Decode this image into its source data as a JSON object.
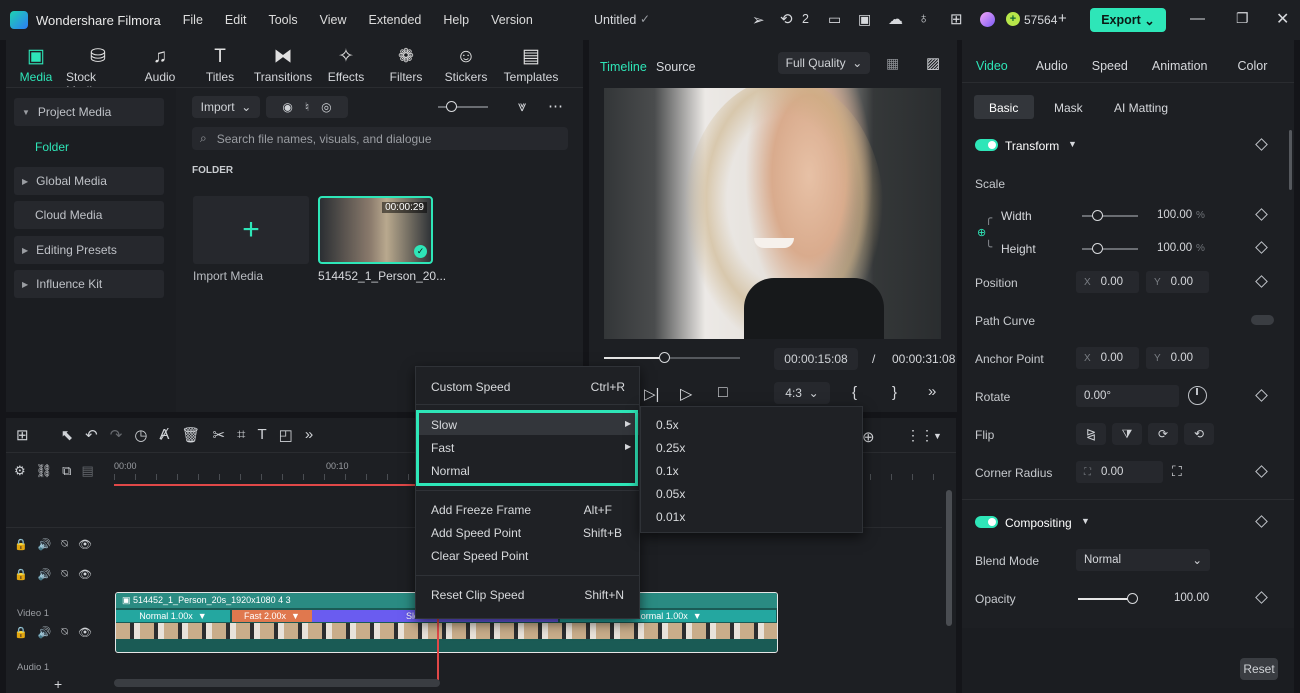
{
  "titlebar": {
    "app_name": "Wondershare Filmora",
    "menu": [
      "File",
      "Edit",
      "Tools",
      "View",
      "Extended",
      "Help",
      "Version"
    ],
    "project_title": "Untitled",
    "badge_count": "2",
    "credits": "57564",
    "export_label": "Export"
  },
  "media_toolbar": {
    "tools": [
      {
        "label": "Media",
        "glyph": "▣",
        "name": "media"
      },
      {
        "label": "Stock Media",
        "glyph": "⛁",
        "name": "stock-media"
      },
      {
        "label": "Audio",
        "glyph": "♫",
        "name": "audio"
      },
      {
        "label": "Titles",
        "glyph": "T",
        "name": "titles"
      },
      {
        "label": "Transitions",
        "glyph": "⧓",
        "name": "transitions"
      },
      {
        "label": "Effects",
        "glyph": "✧",
        "name": "effects"
      },
      {
        "label": "Filters",
        "glyph": "❁",
        "name": "filters"
      },
      {
        "label": "Stickers",
        "glyph": "☺",
        "name": "stickers"
      },
      {
        "label": "Templates",
        "glyph": "▤",
        "name": "templates"
      }
    ]
  },
  "sidebar": {
    "project_media": "Project Media",
    "folder": "Folder",
    "global_media": "Global Media",
    "cloud_media": "Cloud Media",
    "editing_presets": "Editing Presets",
    "influence_kit": "Influence Kit"
  },
  "media_panel": {
    "import_label": "Import",
    "search_placeholder": "Search file names, visuals, and dialogue",
    "folder_heading": "FOLDER",
    "import_media_label": "Import Media",
    "clip_name": "514452_1_Person_20...",
    "clip_duration": "00:00:29"
  },
  "preview": {
    "tab_timeline": "Timeline",
    "tab_source": "Source",
    "quality": "Full Quality",
    "current_time": "00:00:15:08",
    "separator": "/",
    "total_time": "00:00:31:08",
    "aspect": "4:3",
    "progress": 0.44
  },
  "properties": {
    "tabs": [
      "Video",
      "Audio",
      "Speed",
      "Animation",
      "Color"
    ],
    "subtabs": [
      "Basic",
      "Mask",
      "AI Matting"
    ],
    "transform": "Transform",
    "scale": "Scale",
    "width_label": "Width",
    "width_value": "100.00",
    "height_label": "Height",
    "height_value": "100.00",
    "percent": "%",
    "position": "Position",
    "pos_x": "0.00",
    "pos_y": "0.00",
    "x_prefix": "X",
    "y_prefix": "Y",
    "path_curve": "Path Curve",
    "anchor_point": "Anchor Point",
    "anchor_x": "0.00",
    "anchor_y": "0.00",
    "rotate": "Rotate",
    "rotate_value": "0.00°",
    "flip": "Flip",
    "corner_radius": "Corner Radius",
    "corner_value": "0.00",
    "compositing": "Compositing",
    "blend_mode": "Blend Mode",
    "blend_value": "Normal",
    "opacity": "Opacity",
    "opacity_value": "100.00",
    "reset": "Reset"
  },
  "timeline": {
    "ruler": [
      "00:00",
      "00:10"
    ],
    "video_track": "Video 1",
    "audio_track": "Audio 1",
    "clip_title": "514452_1_Person_20s_1920x1080 4 3",
    "segments": [
      {
        "label": "Normal 1.00x",
        "color": "#24a7a0"
      },
      {
        "label": "Fast 2.00x",
        "color": "#e0784e"
      },
      {
        "label": "Slow 0.50x",
        "color": "#6a5cf0"
      },
      {
        "label": "Normal 1.00x",
        "color": "#24a7a0"
      }
    ]
  },
  "context_menu": {
    "custom_speed": "Custom Speed",
    "custom_speed_key": "Ctrl+R",
    "slow": "Slow",
    "fast": "Fast",
    "normal": "Normal",
    "add_freeze": "Add Freeze Frame",
    "add_freeze_key": "Alt+F",
    "add_speed_point": "Add Speed Point",
    "add_speed_point_key": "Shift+B",
    "clear_speed_point": "Clear Speed Point",
    "reset_clip_speed": "Reset Clip Speed",
    "reset_clip_speed_key": "Shift+N"
  },
  "submenu": [
    "0.5x",
    "0.25x",
    "0.1x",
    "0.05x",
    "0.01x"
  ],
  "colors": {
    "accent": "#2ee6b8",
    "highlight": "#2ee6b8",
    "playhead": "#e04848"
  }
}
